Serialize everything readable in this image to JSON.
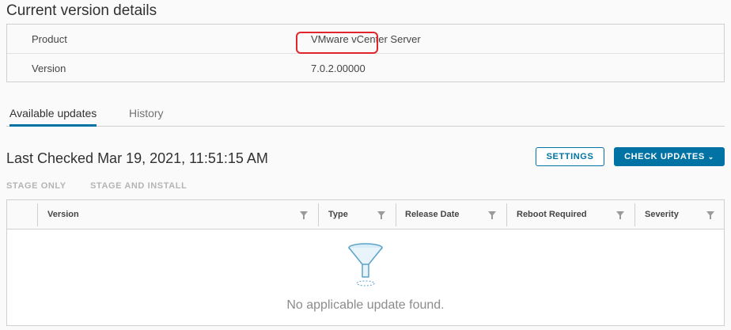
{
  "details": {
    "title": "Current version details",
    "rows": [
      {
        "label": "Product",
        "value": "VMware vCenter Server"
      },
      {
        "label": "Version",
        "value": "7.0.2.00000"
      }
    ]
  },
  "tabs": [
    {
      "label": "Available updates",
      "active": true
    },
    {
      "label": "History",
      "active": false
    }
  ],
  "status": {
    "last_checked": "Last Checked Mar 19, 2021, 11:51:15 AM"
  },
  "toolbar": {
    "settings_label": "SETTINGS",
    "check_updates_label": "CHECK UPDATES",
    "stage_only_label": "STAGE ONLY",
    "stage_install_label": "STAGE AND INSTALL"
  },
  "grid": {
    "columns": [
      "Version",
      "Type",
      "Release Date",
      "Reboot Required",
      "Severity"
    ],
    "empty_message": "No applicable update found."
  },
  "colors": {
    "accent": "#0072a3",
    "highlight": "#e0262b"
  },
  "icons": {
    "filter": "filter-icon",
    "empty": "empty-funnel-icon",
    "dropdown": "chevron-down-icon"
  }
}
